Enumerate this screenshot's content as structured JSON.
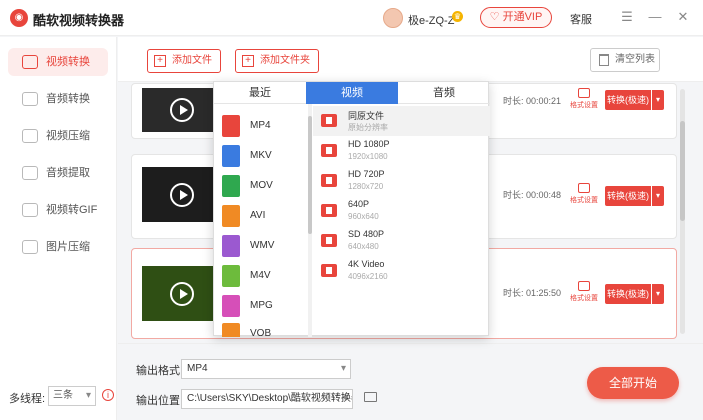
{
  "titlebar": {
    "app_title": "酷软视频转换器",
    "logo_glyph": "◉",
    "username": "极e-ZQ-Z",
    "crown_glyph": "♛",
    "vip_label": "开通VIP",
    "vip_icon": "diamond-icon",
    "service_label": "客服",
    "icons": [
      "menu-icon",
      "minimize-icon",
      "close-icon"
    ],
    "menu_glyph": "☰",
    "minimize_glyph": "—",
    "close_glyph": "✕"
  },
  "sidebar": {
    "items": [
      {
        "label": "视频转换",
        "icon": "video-convert-icon",
        "active": true
      },
      {
        "label": "音频转换",
        "icon": "audio-convert-icon",
        "active": false
      },
      {
        "label": "视频压缩",
        "icon": "video-compress-icon",
        "active": false
      },
      {
        "label": "音频提取",
        "icon": "audio-extract-icon",
        "active": false
      },
      {
        "label": "视频转GIF",
        "icon": "gif-icon",
        "active": false
      },
      {
        "label": "图片压缩",
        "icon": "image-compress-icon",
        "active": false
      }
    ],
    "threads_label": "多线程:",
    "threads_value": "三条",
    "info_glyph": "i"
  },
  "toolbar": {
    "add_file_label": "添加文件",
    "add_folder_label": "添加文件夹",
    "clear_list_label": "清空列表",
    "plus_glyph": "+"
  },
  "files": [
    {
      "duration": "时长: 00:00:21",
      "format_settings": "格式设置",
      "convert_label": "转换(极速)",
      "selected": false
    },
    {
      "duration": "时长: 00:00:48",
      "format_settings": "格式设置",
      "convert_label": "转换(极速)",
      "selected": false
    },
    {
      "duration": "时长: 01:25:50",
      "format_settings": "格式设置",
      "convert_label": "转换(极速)",
      "selected": true
    }
  ],
  "dropdown_glyph": "▾",
  "bottom": {
    "output_format_label": "输出格式",
    "output_format_value": "MP4",
    "output_path_label": "输出位置",
    "output_path_value": "C:\\Users\\SKY\\Desktop\\酷软视频转换器",
    "start_label": "全部开始"
  },
  "format_popup": {
    "tabs": [
      {
        "label": "最近",
        "active": false
      },
      {
        "label": "视频",
        "active": true
      },
      {
        "label": "音频",
        "active": false
      }
    ],
    "formats": [
      {
        "label": "MP4",
        "color": "#e8453c"
      },
      {
        "label": "MKV",
        "color": "#3a7be0"
      },
      {
        "label": "MOV",
        "color": "#2fa84f"
      },
      {
        "label": "AVI",
        "color": "#f08a24"
      },
      {
        "label": "WMV",
        "color": "#9b59d0"
      },
      {
        "label": "M4V",
        "color": "#6dbb3c"
      },
      {
        "label": "MPG",
        "color": "#d64fb8"
      },
      {
        "label": "VOB",
        "color": "#f08a24"
      }
    ],
    "options": [
      {
        "name": "同原文件",
        "sub": "原始分辨率",
        "selected": true
      },
      {
        "name": "HD 1080P",
        "sub": "1920x1080",
        "selected": false
      },
      {
        "name": "HD 720P",
        "sub": "1280x720",
        "selected": false
      },
      {
        "name": "640P",
        "sub": "960x640",
        "selected": false
      },
      {
        "name": "SD 480P",
        "sub": "640x480",
        "selected": false
      },
      {
        "name": "4K Video",
        "sub": "4096x2160",
        "selected": false
      }
    ]
  }
}
